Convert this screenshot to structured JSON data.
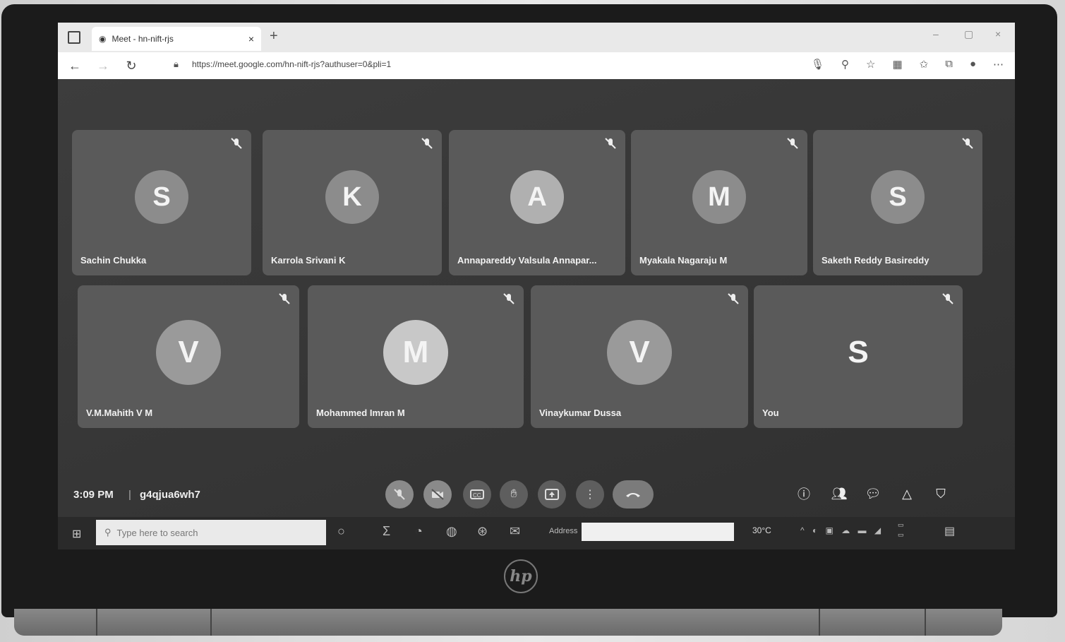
{
  "browser": {
    "tab_title": "Meet - hn-nift-rjs",
    "tab_close": "×",
    "new_tab": "+",
    "url": "https://meet.google.com/hn-nift-rjs?authuser=0&pli=1",
    "window_controls": [
      "–",
      "▢",
      "×"
    ]
  },
  "participants": [
    {
      "initial": "S",
      "name": "Sachin Chukka",
      "muted": true
    },
    {
      "initial": "K",
      "name": "Karrola Srivani K",
      "muted": true
    },
    {
      "initial": "A",
      "name": "Annapareddy Valsula Annapar...",
      "muted": true
    },
    {
      "initial": "M",
      "name": "Myakala Nagaraju M",
      "muted": true
    },
    {
      "initial": "S",
      "name": "Saketh Reddy Basireddy",
      "muted": true
    },
    {
      "initial": "V",
      "name": "V.M.Mahith V M",
      "muted": true
    },
    {
      "initial": "M",
      "name": "Mohammed Imran M",
      "muted": true
    },
    {
      "initial": "V",
      "name": "Vinaykumar Dussa",
      "muted": true
    },
    {
      "initial": "S",
      "name": "You",
      "muted": true
    }
  ],
  "meeting": {
    "time": "3:09 PM",
    "separator": "|",
    "code": "g4qjua6wh7"
  },
  "controls": {
    "mic_icon": "mic-off-icon",
    "camera_icon": "camera-off-icon",
    "captions_icon": "captions-icon",
    "hand_icon": "raise-hand-icon",
    "present_icon": "present-screen-icon",
    "more_icon": "more-options-icon",
    "end_icon": "end-call-icon"
  },
  "taskbar": {
    "search_placeholder": "Type here to search",
    "address_label": "Address",
    "temperature": "30°C"
  },
  "laptop": {
    "brand": "hp"
  }
}
